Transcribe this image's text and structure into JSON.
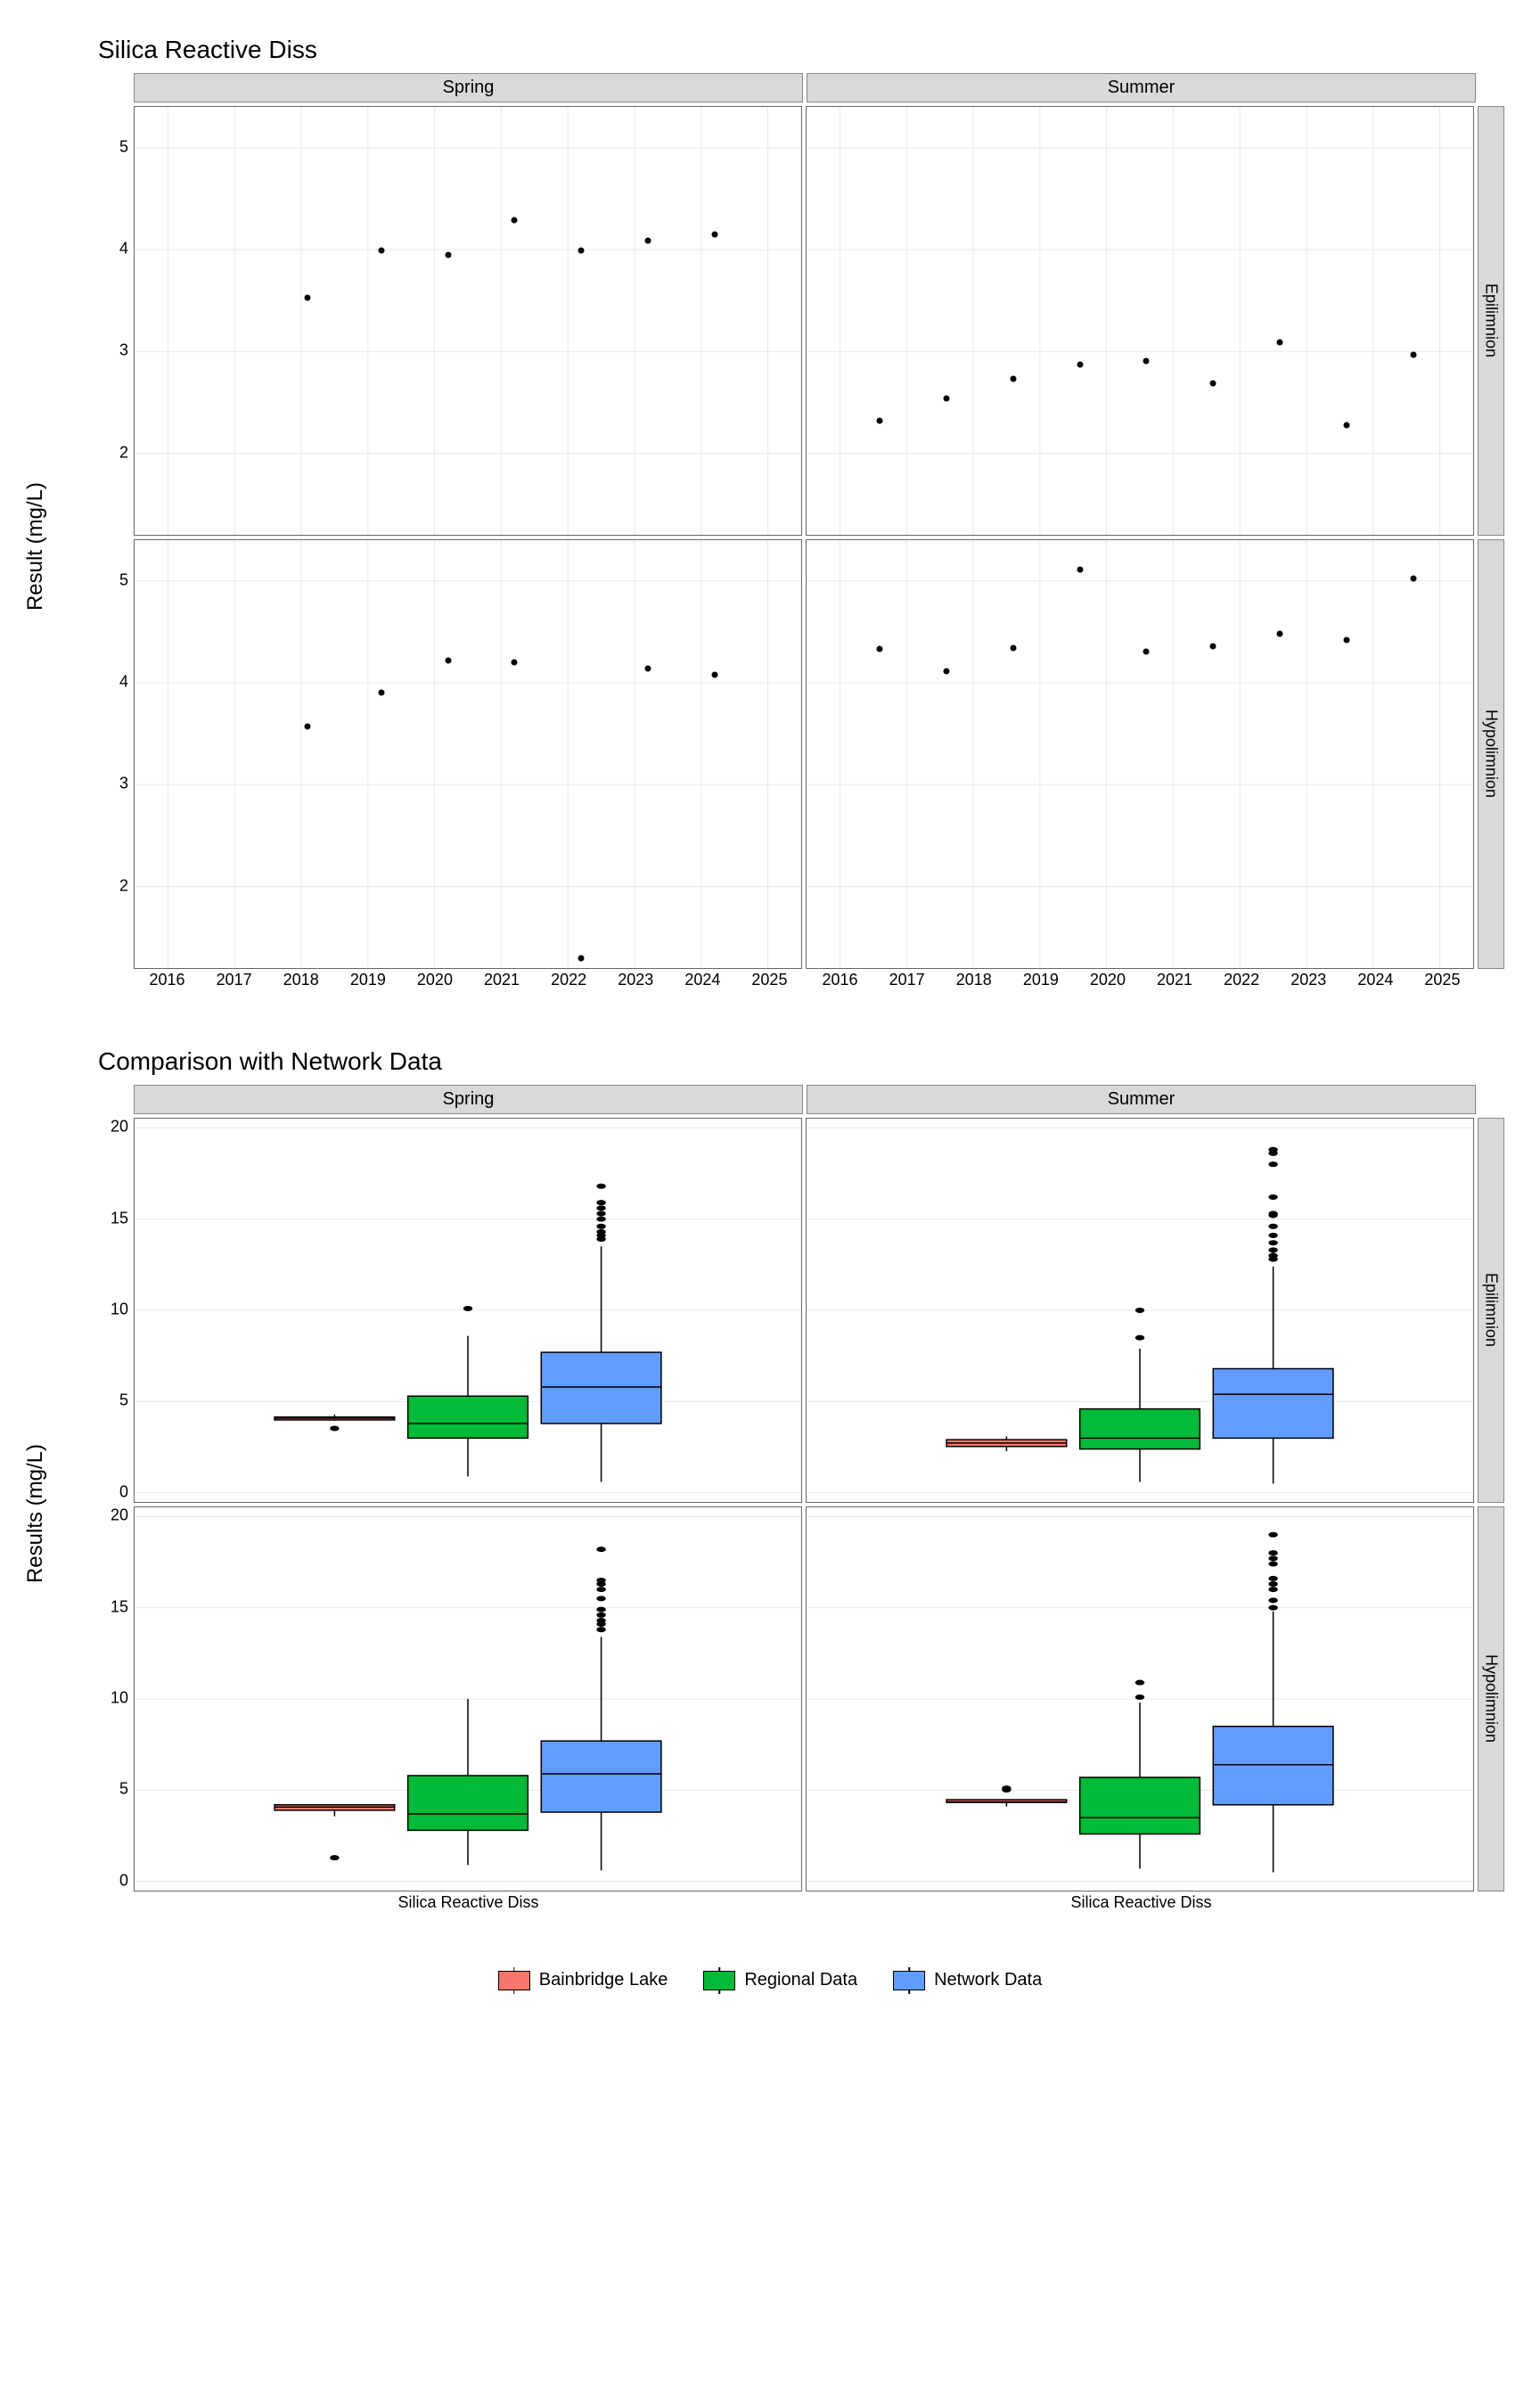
{
  "chart_data": [
    {
      "type": "scatter",
      "title": "Silica Reactive Diss",
      "ylabel": "Result (mg/L)",
      "x_range": [
        2015.5,
        2025.5
      ],
      "x_ticks": [
        2016,
        2017,
        2018,
        2019,
        2020,
        2021,
        2022,
        2023,
        2024,
        2025
      ],
      "y_range": [
        1.2,
        5.4
      ],
      "y_ticks": [
        2,
        3,
        4,
        5
      ],
      "col_facets": [
        "Spring",
        "Summer"
      ],
      "row_facets": [
        "Epilimnion",
        "Hypolimnion"
      ],
      "panels": {
        "Spring|Epilimnion": [
          {
            "x": 2018.1,
            "y": 3.53
          },
          {
            "x": 2019.2,
            "y": 3.99
          },
          {
            "x": 2020.2,
            "y": 3.95
          },
          {
            "x": 2021.2,
            "y": 4.29
          },
          {
            "x": 2022.2,
            "y": 3.99
          },
          {
            "x": 2023.2,
            "y": 4.09
          },
          {
            "x": 2024.2,
            "y": 4.15
          }
        ],
        "Summer|Epilimnion": [
          {
            "x": 2016.6,
            "y": 2.32
          },
          {
            "x": 2017.6,
            "y": 2.54
          },
          {
            "x": 2018.6,
            "y": 2.73
          },
          {
            "x": 2019.6,
            "y": 2.87
          },
          {
            "x": 2020.6,
            "y": 2.91
          },
          {
            "x": 2021.6,
            "y": 2.69
          },
          {
            "x": 2022.6,
            "y": 3.09
          },
          {
            "x": 2023.6,
            "y": 2.28
          },
          {
            "x": 2024.6,
            "y": 2.97
          }
        ],
        "Spring|Hypolimnion": [
          {
            "x": 2018.1,
            "y": 3.57
          },
          {
            "x": 2019.2,
            "y": 3.9
          },
          {
            "x": 2020.2,
            "y": 4.22
          },
          {
            "x": 2021.2,
            "y": 4.2
          },
          {
            "x": 2022.2,
            "y": 1.3
          },
          {
            "x": 2023.2,
            "y": 4.14
          },
          {
            "x": 2024.2,
            "y": 4.08
          }
        ],
        "Summer|Hypolimnion": [
          {
            "x": 2016.6,
            "y": 4.33
          },
          {
            "x": 2017.6,
            "y": 4.11
          },
          {
            "x": 2018.6,
            "y": 4.34
          },
          {
            "x": 2019.6,
            "y": 5.11
          },
          {
            "x": 2020.6,
            "y": 4.31
          },
          {
            "x": 2021.6,
            "y": 4.36
          },
          {
            "x": 2022.6,
            "y": 4.48
          },
          {
            "x": 2023.6,
            "y": 4.42
          },
          {
            "x": 2024.6,
            "y": 5.02
          }
        ]
      }
    },
    {
      "type": "box",
      "title": "Comparison with Network Data",
      "ylabel": "Results (mg/L)",
      "x_category": "Silica Reactive Diss",
      "y_range": [
        -0.5,
        20.5
      ],
      "y_ticks": [
        0,
        5,
        10,
        15,
        20
      ],
      "col_facets": [
        "Spring",
        "Summer"
      ],
      "row_facets": [
        "Epilimnion",
        "Hypolimnion"
      ],
      "groups": [
        "Bainbridge Lake",
        "Regional Data",
        "Network Data"
      ],
      "colors": {
        "Bainbridge Lake": "#f8766d",
        "Regional Data": "#00ba38",
        "Network Data": "#619cff"
      },
      "panels": {
        "Spring|Epilimnion": {
          "Bainbridge Lake": {
            "min": 3.95,
            "q1": 3.99,
            "med": 4.09,
            "q3": 4.15,
            "max": 4.29,
            "out": [
              3.53
            ]
          },
          "Regional Data": {
            "min": 0.9,
            "q1": 3.0,
            "med": 3.8,
            "q3": 5.3,
            "max": 8.6,
            "out": [
              10.1
            ]
          },
          "Network Data": {
            "min": 0.6,
            "q1": 3.8,
            "med": 5.8,
            "q3": 7.7,
            "max": 13.5,
            "out": [
              13.9,
              14.1,
              14.3,
              14.6,
              15.0,
              15.3,
              15.6,
              15.9,
              16.8
            ]
          }
        },
        "Summer|Epilimnion": {
          "Bainbridge Lake": {
            "min": 2.28,
            "q1": 2.54,
            "med": 2.73,
            "q3": 2.91,
            "max": 3.09,
            "out": []
          },
          "Regional Data": {
            "min": 0.6,
            "q1": 2.4,
            "med": 3.0,
            "q3": 4.6,
            "max": 7.9,
            "out": [
              8.5,
              10.0
            ]
          },
          "Network Data": {
            "min": 0.5,
            "q1": 3.0,
            "med": 5.4,
            "q3": 6.8,
            "max": 12.4,
            "out": [
              12.8,
              13.0,
              13.3,
              13.7,
              14.1,
              14.6,
              15.2,
              15.3,
              16.2,
              18.0,
              18.6,
              18.8
            ]
          }
        },
        "Spring|Hypolimnion": {
          "Bainbridge Lake": {
            "min": 3.57,
            "q1": 3.9,
            "med": 4.08,
            "q3": 4.2,
            "max": 4.22,
            "out": [
              1.3
            ]
          },
          "Regional Data": {
            "min": 0.9,
            "q1": 2.8,
            "med": 3.7,
            "q3": 5.8,
            "max": 10.0,
            "out": []
          },
          "Network Data": {
            "min": 0.6,
            "q1": 3.8,
            "med": 5.9,
            "q3": 7.7,
            "max": 13.4,
            "out": [
              13.8,
              14.1,
              14.3,
              14.6,
              14.9,
              15.5,
              16.0,
              16.3,
              16.5,
              18.2
            ]
          }
        },
        "Summer|Hypolimnion": {
          "Bainbridge Lake": {
            "min": 4.11,
            "q1": 4.33,
            "med": 4.36,
            "q3": 4.48,
            "max": 4.48,
            "out": [
              5.11,
              5.02
            ]
          },
          "Regional Data": {
            "min": 0.7,
            "q1": 2.6,
            "med": 3.5,
            "q3": 5.7,
            "max": 9.8,
            "out": [
              10.1,
              10.9
            ]
          },
          "Network Data": {
            "min": 0.5,
            "q1": 4.2,
            "med": 6.4,
            "q3": 8.5,
            "max": 14.8,
            "out": [
              15.0,
              15.4,
              16.0,
              16.3,
              16.6,
              17.4,
              17.7,
              18.0,
              19.0
            ]
          }
        }
      }
    }
  ],
  "legend": {
    "items": [
      {
        "label": "Bainbridge Lake",
        "color": "#f8766d"
      },
      {
        "label": "Regional Data",
        "color": "#00ba38"
      },
      {
        "label": "Network Data",
        "color": "#619cff"
      }
    ]
  }
}
